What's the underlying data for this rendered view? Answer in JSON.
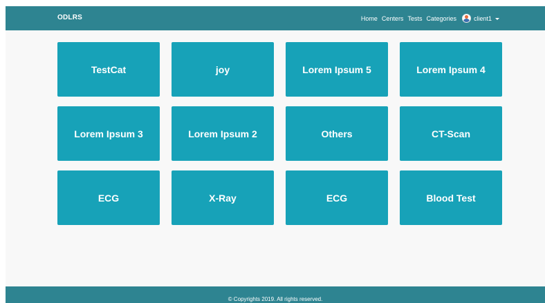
{
  "navbar": {
    "brand": "ODLRS",
    "links": [
      "Home",
      "Centers",
      "Tests",
      "Categories"
    ],
    "user": {
      "name": "client1",
      "avatar_icon": "user-avatar-icon",
      "dropdown_icon": "caret-down-icon"
    }
  },
  "categories": [
    "TestCat",
    "joy",
    "Lorem Ipsum 5",
    "Lorem Ipsum 4",
    "Lorem Ipsum 3",
    "Lorem Ipsum 2",
    "Others",
    "CT-Scan",
    "ECG",
    "X-Ray",
    "ECG",
    "Blood Test"
  ],
  "footer": {
    "text": "© Copyrights 2019. All rights reserved."
  },
  "colors": {
    "navbar": "#2e8491",
    "tile": "#17a2b8",
    "background": "#f8f8f8",
    "text_on_dark": "#ffffff"
  }
}
